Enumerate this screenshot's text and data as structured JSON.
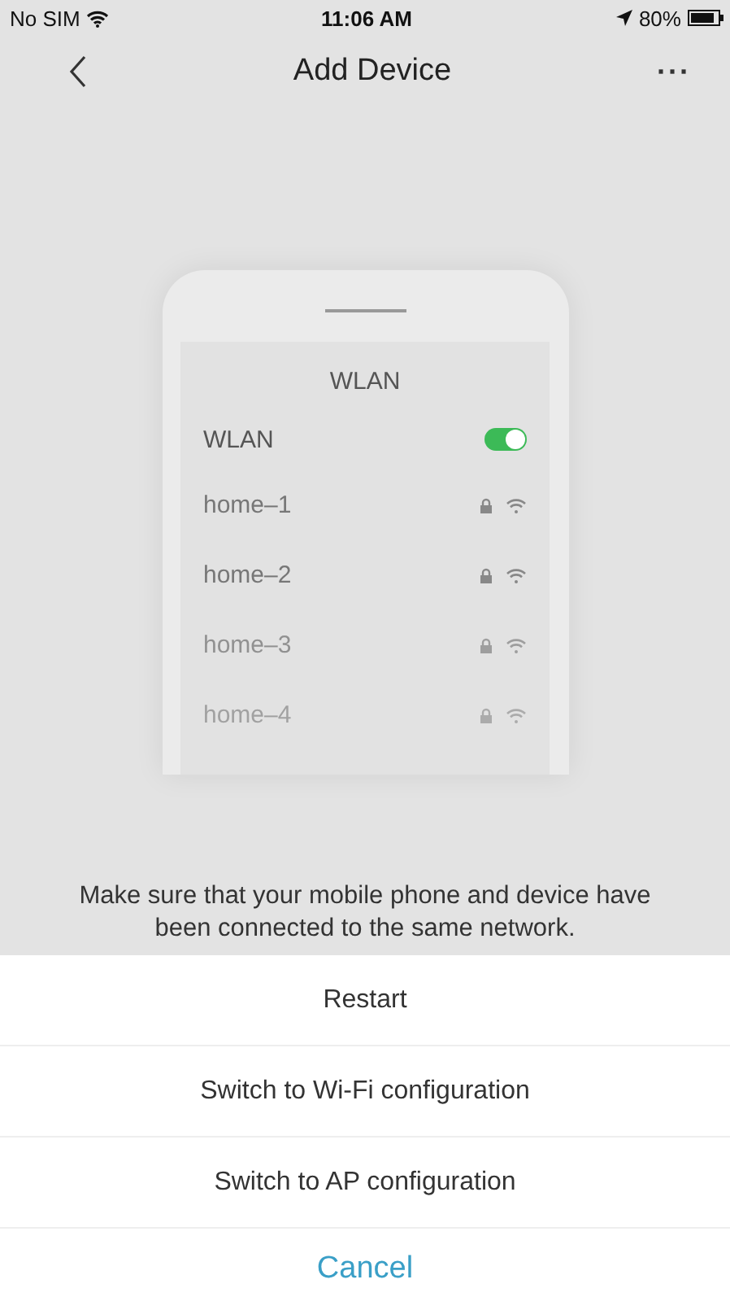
{
  "status_bar": {
    "carrier": "No SIM",
    "time": "11:06 AM",
    "battery": "80%"
  },
  "nav": {
    "title": "Add Device",
    "more": "···"
  },
  "illustration": {
    "title": "WLAN",
    "toggle": {
      "label": "WLAN",
      "on": true
    },
    "networks": [
      {
        "name": "home–1"
      },
      {
        "name": "home–2"
      },
      {
        "name": "home–3"
      },
      {
        "name": "home–4"
      }
    ]
  },
  "message": "Make sure that your mobile phone and device have been connected to the same network.",
  "actions": [
    {
      "label": "Restart",
      "kind": "default"
    },
    {
      "label": "Switch to Wi-Fi configuration",
      "kind": "default"
    },
    {
      "label": "Switch to AP configuration",
      "kind": "default"
    },
    {
      "label": "Cancel",
      "kind": "cancel"
    }
  ]
}
